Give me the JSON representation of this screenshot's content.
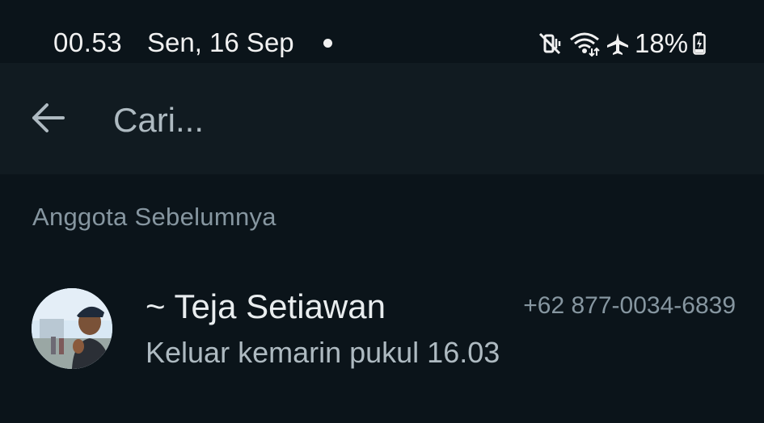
{
  "status_bar": {
    "time": "00.53",
    "date": "Sen, 16 Sep",
    "battery": "18%",
    "icons": [
      "notification-dot-icon",
      "vibrate-mute-icon",
      "wifi-icon",
      "airplane-icon",
      "battery-charging-icon"
    ]
  },
  "search": {
    "placeholder": "Cari..."
  },
  "section": {
    "title": "Anggota Sebelumnya"
  },
  "members": [
    {
      "name": "~ Teja Setiawan",
      "phone": "+62 877-0034-6839",
      "status": "Keluar kemarin pukul 16.03"
    }
  ],
  "colors": {
    "background": "#0b141a",
    "search_bar": "#111b21",
    "primary_text": "#e9edef",
    "secondary_text": "#8696a0"
  }
}
